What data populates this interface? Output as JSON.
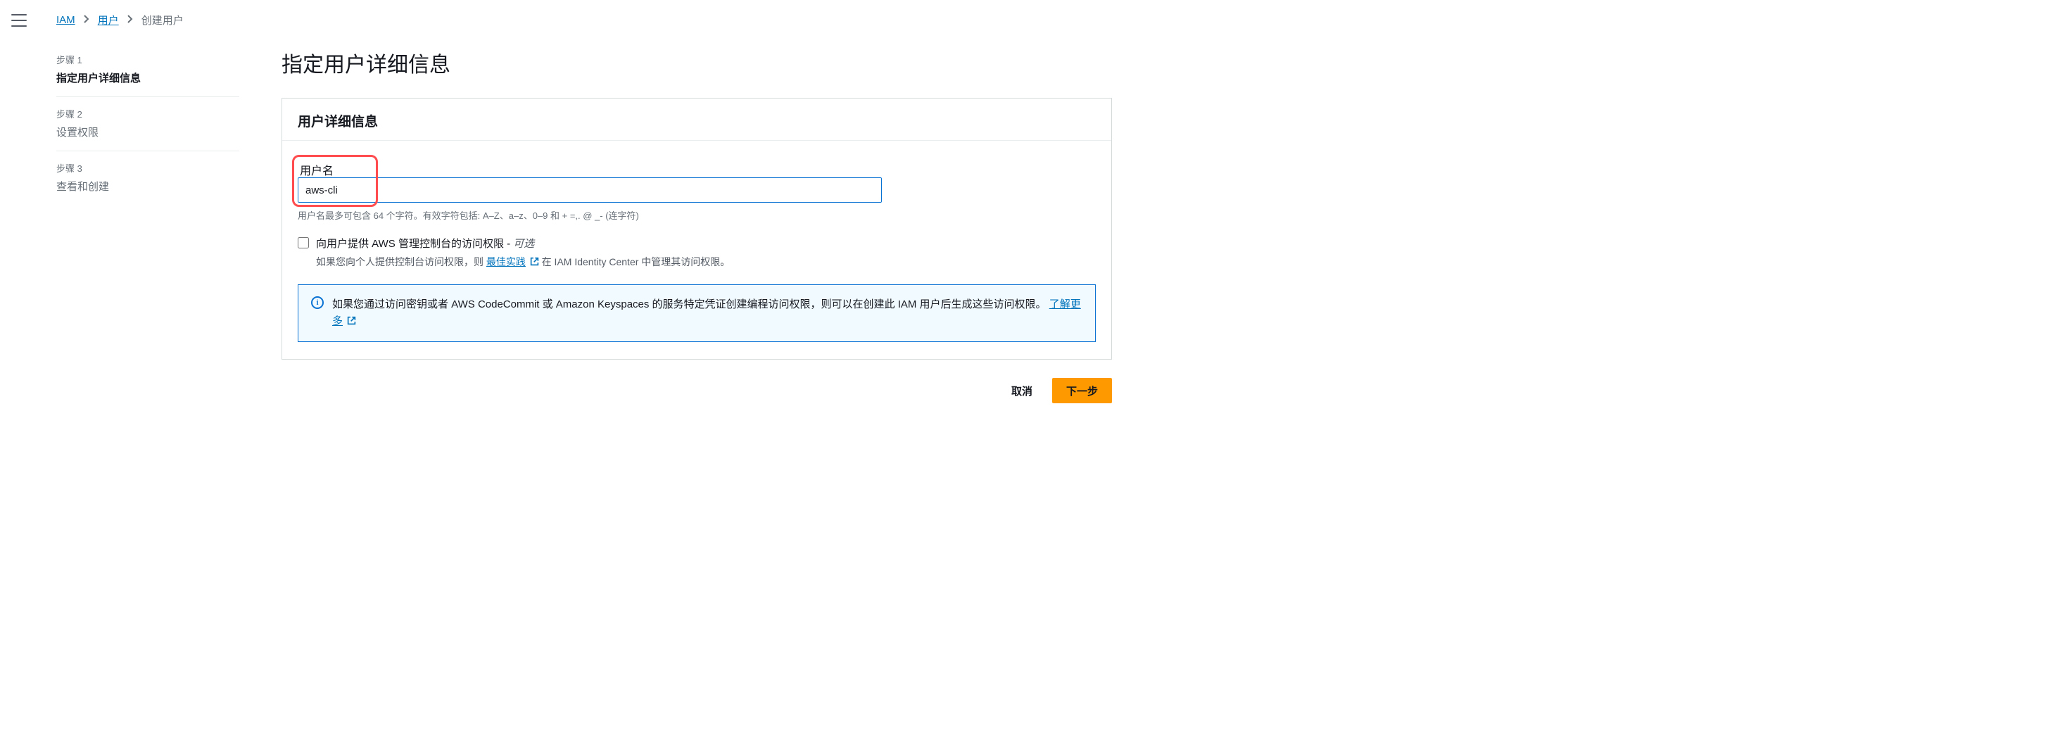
{
  "breadcrumb": {
    "iam": "IAM",
    "users": "用户",
    "create_user": "创建用户"
  },
  "steps": [
    {
      "label": "步骤 1",
      "title": "指定用户详细信息"
    },
    {
      "label": "步骤 2",
      "title": "设置权限"
    },
    {
      "label": "步骤 3",
      "title": "查看和创建"
    }
  ],
  "page_title": "指定用户详细信息",
  "panel_title": "用户详细信息",
  "username": {
    "label": "用户名",
    "value": "aws-cli",
    "hint": "用户名最多可包含 64 个字符。有效字符包括: A–Z、a–z、0–9 和 + =,. @ _- (连字符)"
  },
  "console_access": {
    "label_main": "向用户提供 AWS 管理控制台的访问权限 - ",
    "label_optional": "可选",
    "sub_prefix": "如果您向个人提供控制台访问权限，则 ",
    "best_practices": "最佳实践",
    "sub_suffix": " 在 IAM Identity Center 中管理其访问权限。"
  },
  "info_box": {
    "text": "如果您通过访问密钥或者 AWS CodeCommit 或 Amazon Keyspaces 的服务特定凭证创建编程访问权限，则可以在创建此 IAM 用户后生成这些访问权限。",
    "learn_more": "了解更多"
  },
  "buttons": {
    "cancel": "取消",
    "next": "下一步"
  }
}
